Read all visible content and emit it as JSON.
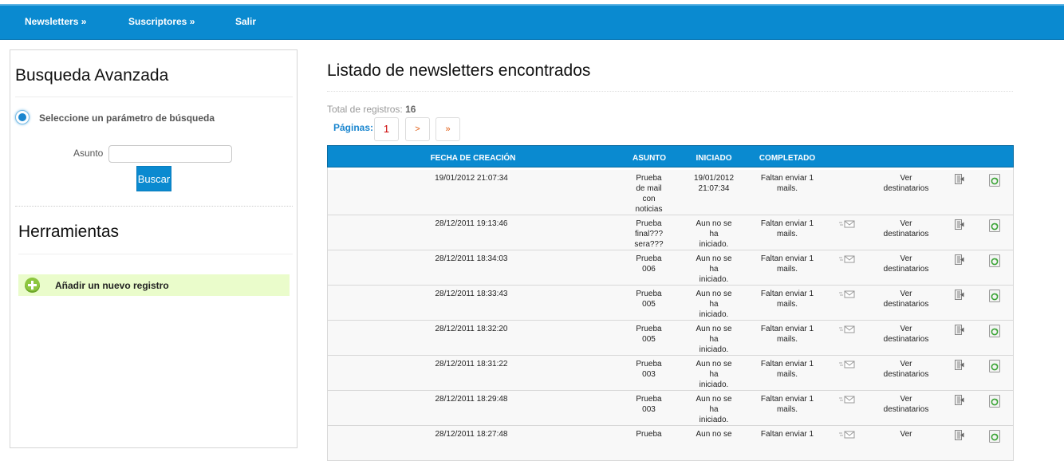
{
  "nav": {
    "newsletters": "Newsletters »",
    "suscriptores": "Suscriptores »",
    "salir": "Salir"
  },
  "sidebar": {
    "search_title": "Busqueda Avanzada",
    "radio_label": "Seleccione un parámetro de búsqueda",
    "asunto_label": "Asunto",
    "asunto_value": "",
    "buscar_label": "Buscar",
    "tools_title": "Herramientas",
    "add_label": "Añadir un nuevo registro"
  },
  "main": {
    "title": "Listado de newsletters encontrados",
    "total_label": "Total de registros:",
    "total_value": "16",
    "pages_label": "Páginas:",
    "pages": [
      "1",
      ">",
      "»"
    ]
  },
  "table": {
    "headers": [
      "FECHA DE CREACIÓN",
      "ASUNTO",
      "INICIADO",
      "COMPLETADO"
    ],
    "rows": [
      {
        "fecha": "19/01/2012 21:07:34",
        "asunto": [
          "Prueba",
          "de mail",
          "con",
          "noticias"
        ],
        "iniciado": [
          "19/01/2012",
          "21:07:34"
        ],
        "completado": [
          "Faltan enviar 1",
          "mails."
        ],
        "ver": [
          "Ver",
          "destinatarios"
        ],
        "mail_icon": false
      },
      {
        "fecha": "28/12/2011 19:13:46",
        "asunto": [
          "Prueba",
          "final???",
          "sera???"
        ],
        "iniciado": [
          "Aun no se",
          "ha",
          "iniciado."
        ],
        "completado": [
          "Faltan enviar 1",
          "mails."
        ],
        "ver": [
          "Ver",
          "destinatarios"
        ],
        "mail_icon": true
      },
      {
        "fecha": "28/12/2011 18:34:03",
        "asunto": [
          "Prueba",
          "006"
        ],
        "iniciado": [
          "Aun no se",
          "ha",
          "iniciado."
        ],
        "completado": [
          "Faltan enviar 1",
          "mails."
        ],
        "ver": [
          "Ver",
          "destinatarios"
        ],
        "mail_icon": true
      },
      {
        "fecha": "28/12/2011 18:33:43",
        "asunto": [
          "Prueba",
          "005"
        ],
        "iniciado": [
          "Aun no se",
          "ha",
          "iniciado."
        ],
        "completado": [
          "Faltan enviar 1",
          "mails."
        ],
        "ver": [
          "Ver",
          "destinatarios"
        ],
        "mail_icon": true
      },
      {
        "fecha": "28/12/2011 18:32:20",
        "asunto": [
          "Prueba",
          "005"
        ],
        "iniciado": [
          "Aun no se",
          "ha",
          "iniciado."
        ],
        "completado": [
          "Faltan enviar 1",
          "mails."
        ],
        "ver": [
          "Ver",
          "destinatarios"
        ],
        "mail_icon": true
      },
      {
        "fecha": "28/12/2011 18:31:22",
        "asunto": [
          "Prueba",
          "003"
        ],
        "iniciado": [
          "Aun no se",
          "ha",
          "iniciado."
        ],
        "completado": [
          "Faltan enviar 1",
          "mails."
        ],
        "ver": [
          "Ver",
          "destinatarios"
        ],
        "mail_icon": true
      },
      {
        "fecha": "28/12/2011 18:29:48",
        "asunto": [
          "Prueba",
          "003"
        ],
        "iniciado": [
          "Aun no se",
          "ha",
          "iniciado."
        ],
        "completado": [
          "Faltan enviar 1",
          "mails."
        ],
        "ver": [
          "Ver",
          "destinatarios"
        ],
        "mail_icon": true
      },
      {
        "fecha": "28/12/2011 18:27:48",
        "asunto": [
          "Prueba"
        ],
        "iniciado": [
          "Aun no se"
        ],
        "completado": [
          "Faltan enviar 1"
        ],
        "ver": [
          "Ver"
        ],
        "mail_icon": true
      }
    ]
  },
  "colors": {
    "accent": "#0a8ad0",
    "add_row_bg": "#eafccb",
    "add_icon": "#8dc63f"
  },
  "icons": {
    "radio": "radio-selected-icon",
    "add": "plus-circle-icon",
    "mail": "mail-send-icon",
    "edit": "edit-exit-icon",
    "delete": "recycle-bin-icon"
  }
}
